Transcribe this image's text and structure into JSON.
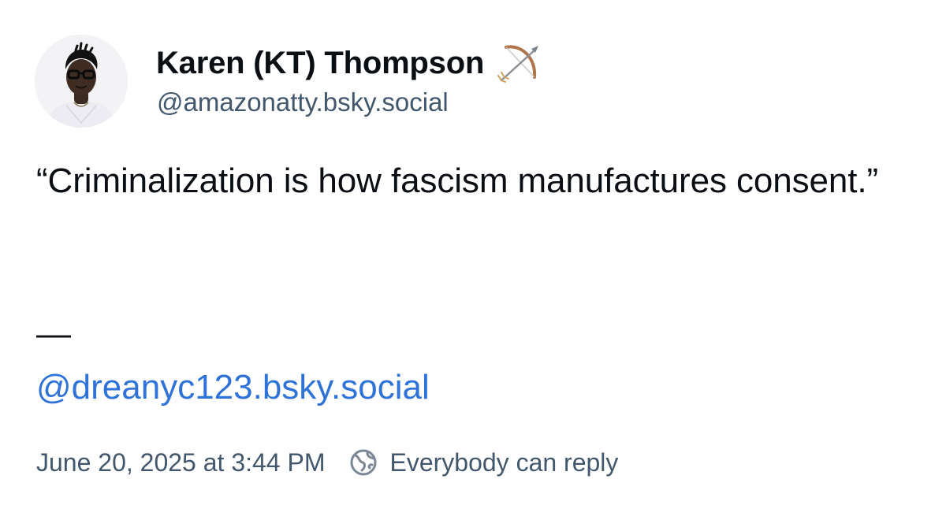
{
  "author": {
    "display_name": "Karen (KT) Thompson",
    "handle": "@amazonatty.bsky.social",
    "avatar_icon": "avatar-photo",
    "badge_icon": "bow-and-arrow-icon"
  },
  "post": {
    "text": "“Criminalization is how fascism manufactures consent.”",
    "separator": "—",
    "mention": "@dreanyc123.bsky.social"
  },
  "meta": {
    "timestamp": "June 20, 2025 at 3:44 PM",
    "reply_setting": "Everybody can reply",
    "reply_icon": "globe-icon"
  },
  "colors": {
    "text": "#0b0f14",
    "secondary": "#42576c",
    "link": "#2f72d8",
    "background": "#ffffff"
  }
}
